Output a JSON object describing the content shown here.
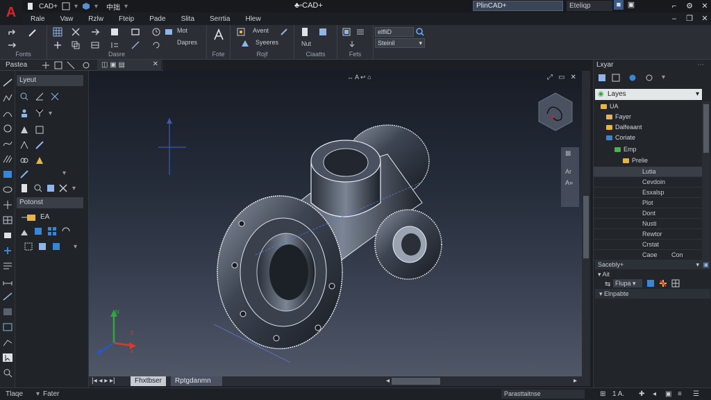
{
  "app": {
    "logo": "A",
    "qat_title": "CAD+",
    "qat_label": "中拙",
    "title": "CAD+",
    "title_search_value": "PlinCAD+",
    "title_user": "Eteliqp"
  },
  "menu": [
    "Rale",
    "Vaw",
    "Rzlw",
    "Fteip",
    "Pade",
    "Slita",
    "Serrtia",
    "Hlew"
  ],
  "ribbon": {
    "group_labels": [
      "Fonts",
      "Dasre",
      "Fote",
      "Rojf",
      "Ciaatts",
      "Fets"
    ],
    "texts": {
      "mot": "Mot",
      "dapres": "Dapres",
      "avent": "Avent",
      "syeeres": "Syeeres",
      "nut": "Nut",
      "search_value": "elfliD",
      "select_value": "Steinil"
    }
  },
  "tabstrip": {
    "label": "Pastea"
  },
  "left_panel": {
    "head1": "Lyeut",
    "head2": "Potonst",
    "ea": "EA"
  },
  "viewport": {
    "nav_label": "A",
    "viewcube": "Top"
  },
  "bottom_tabs": [
    "Fhxtbser",
    "Rptgdanmn"
  ],
  "status": {
    "left": "Tlaqe",
    "left2": "Fater",
    "right_scale": "1 A.",
    "right_field": "Parasttaitnse"
  },
  "right_panel": {
    "title": "Lxyar",
    "layer_selector": "Layes",
    "tree": [
      {
        "label": "UA",
        "icon": "folder",
        "indent": 1
      },
      {
        "label": "Fayer",
        "icon": "folder",
        "indent": 2
      },
      {
        "label": "Dalfeaant",
        "icon": "folder",
        "indent": 2
      },
      {
        "label": "Coriate",
        "icon": "folder-blue",
        "indent": 2
      },
      {
        "label": "Emp",
        "icon": "folder-green",
        "indent": 3
      },
      {
        "label": "Prelie",
        "icon": "folder",
        "indent": 4
      }
    ],
    "properties": [
      {
        "label": "Lutia",
        "value": ""
      },
      {
        "label": "Cevdoin",
        "value": ""
      },
      {
        "label": "Esxalsp",
        "value": ""
      },
      {
        "label": "Plot",
        "value": ""
      },
      {
        "label": "Dont",
        "value": ""
      },
      {
        "label": "Nusti",
        "value": ""
      },
      {
        "label": "Rewtor",
        "value": ""
      },
      {
        "label": "Crstat",
        "value": ""
      },
      {
        "label": "Caoe",
        "value": "Con"
      }
    ],
    "sec_header": "Sacebly+",
    "sub_label": "Ait",
    "sub_select": "Flupa",
    "footer_label": "Elnpabte"
  },
  "colors": {
    "accent_blue": "#3a86d6",
    "folder_yellow": "#e7b547",
    "logo_red": "#d6262c"
  }
}
